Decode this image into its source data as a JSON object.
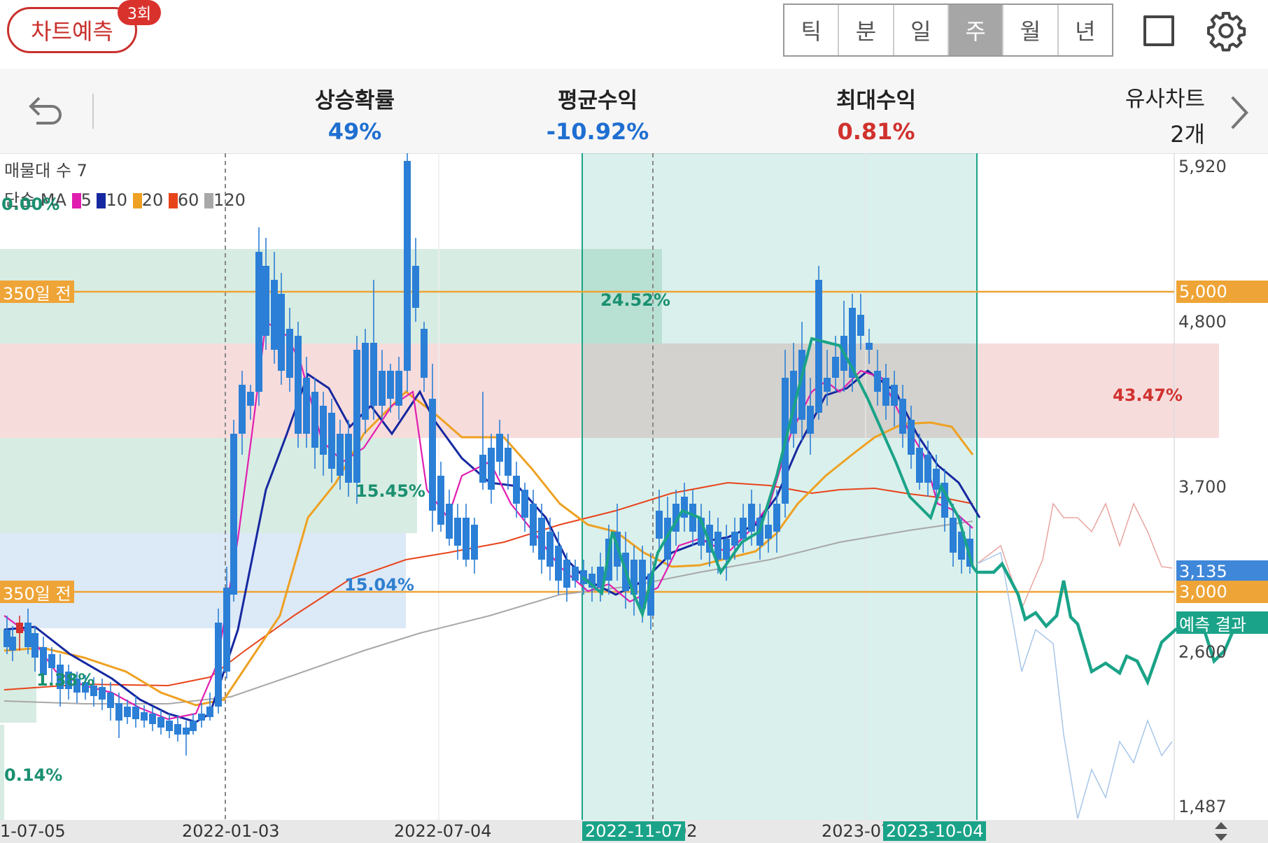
{
  "header": {
    "predict_label": "차트예측",
    "predict_badge": "3회",
    "period_tabs": [
      "틱",
      "분",
      "일",
      "주",
      "월",
      "년"
    ],
    "active_tab": "주",
    "icons": [
      "square-icon",
      "gear-icon"
    ]
  },
  "stats": {
    "rise_prob_label": "상승확률",
    "rise_prob_value": "49%",
    "avg_return_label": "평균수익",
    "avg_return_value": "-10.92%",
    "max_return_label": "최대수익",
    "max_return_value": "0.81%",
    "similar_label": "유사차트",
    "similar_value": "2개",
    "colors": {
      "blue": "#1f6fd1",
      "red": "#d0322e"
    }
  },
  "chart": {
    "legend_volume": "매물대 수 7",
    "legend_ma_prefix": "단순 MA",
    "ma": [
      {
        "period": "5",
        "color": "#e01eb0"
      },
      {
        "period": "10",
        "color": "#1628a0"
      },
      {
        "period": "20",
        "color": "#eea122"
      },
      {
        "period": "60",
        "color": "#e8441c"
      },
      {
        "period": "120",
        "color": "#a8a8a8"
      }
    ],
    "zone_percents": [
      "0.00%",
      "24.52%",
      "43.47%",
      "15.45%",
      "15.04%",
      "1.38%",
      "0.14%"
    ],
    "ref_lines": [
      "350일 전",
      "350일 전"
    ],
    "price_axis": [
      "5,920",
      "4,800",
      "3,700",
      "2,600",
      "1,487"
    ],
    "price_tags": [
      {
        "text": "5,000",
        "color": "#eea436"
      },
      {
        "text": "3,135",
        "color": "#3f87d8"
      },
      {
        "text": "3,000",
        "color": "#eea436"
      },
      {
        "text": "예측 결과",
        "color": "#1aa388"
      }
    ],
    "x_labels": [
      "1-07-05",
      "2022-01-03",
      "2022-07-04",
      "02",
      "2023-07"
    ],
    "x_highlight_labels": [
      "2022-11-07",
      "2023-10-04"
    ]
  }
}
